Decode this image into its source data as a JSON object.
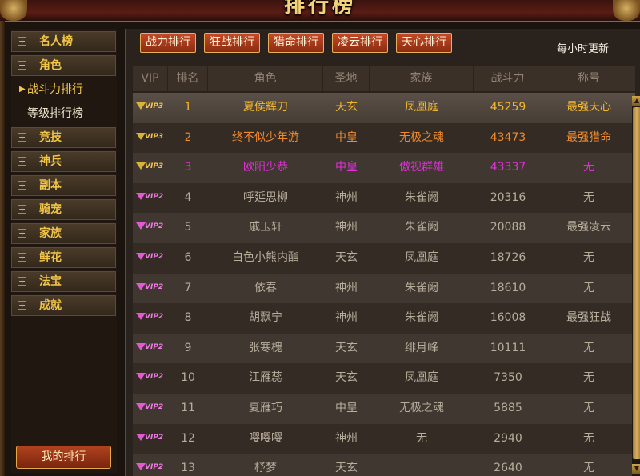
{
  "window": {
    "title": "排行榜"
  },
  "sidebar": {
    "items": [
      {
        "label": "名人榜",
        "toggle": "+"
      },
      {
        "label": "角色",
        "toggle": "−"
      },
      {
        "label": "竞技",
        "toggle": "+"
      },
      {
        "label": "神兵",
        "toggle": "+"
      },
      {
        "label": "副本",
        "toggle": "+"
      },
      {
        "label": "骑宠",
        "toggle": "+"
      },
      {
        "label": "家族",
        "toggle": "+"
      },
      {
        "label": "鲜花",
        "toggle": "+"
      },
      {
        "label": "法宝",
        "toggle": "+"
      },
      {
        "label": "成就",
        "toggle": "+"
      }
    ],
    "sub_items": [
      {
        "label": "战斗力排行",
        "active": true
      },
      {
        "label": "等级排行榜",
        "active": false
      }
    ],
    "my_rank_button": "我的排行"
  },
  "tabs": [
    "战力排行",
    "狂战排行",
    "猎命排行",
    "凌云排行",
    "天心排行"
  ],
  "update_note": "每小时更新",
  "table": {
    "headers": [
      "VIP",
      "排名",
      "角色",
      "圣地",
      "家族",
      "战斗力",
      "称号"
    ],
    "rows": [
      {
        "vip": "VIP3",
        "rank": "1",
        "name": "夏侯辉刀",
        "holyland": "天玄",
        "family": "凤凰庭",
        "power": "45259",
        "title": "最强天心"
      },
      {
        "vip": "VIP3",
        "rank": "2",
        "name": "终不似少年游",
        "holyland": "中皇",
        "family": "无极之魂",
        "power": "43473",
        "title": "最强猎命"
      },
      {
        "vip": "VIP3",
        "rank": "3",
        "name": "欧阳少恭",
        "holyland": "中皇",
        "family": "傲视群雄",
        "power": "43337",
        "title": "无"
      },
      {
        "vip": "VIP2",
        "rank": "4",
        "name": "呼延思柳",
        "holyland": "神州",
        "family": "朱雀阙",
        "power": "20316",
        "title": "无"
      },
      {
        "vip": "VIP2",
        "rank": "5",
        "name": "戚玉轩",
        "holyland": "神州",
        "family": "朱雀阙",
        "power": "20088",
        "title": "最强凌云"
      },
      {
        "vip": "VIP2",
        "rank": "6",
        "name": "白色小熊内酯",
        "holyland": "天玄",
        "family": "凤凰庭",
        "power": "18726",
        "title": "无"
      },
      {
        "vip": "VIP2",
        "rank": "7",
        "name": "依春",
        "holyland": "神州",
        "family": "朱雀阙",
        "power": "18610",
        "title": "无"
      },
      {
        "vip": "VIP2",
        "rank": "8",
        "name": "胡飘宁",
        "holyland": "神州",
        "family": "朱雀阙",
        "power": "16008",
        "title": "最强狂战"
      },
      {
        "vip": "VIP2",
        "rank": "9",
        "name": "张寒槐",
        "holyland": "天玄",
        "family": "绯月峰",
        "power": "10111",
        "title": "无"
      },
      {
        "vip": "VIP2",
        "rank": "10",
        "name": "江雁蕊",
        "holyland": "天玄",
        "family": "凤凰庭",
        "power": "7350",
        "title": "无"
      },
      {
        "vip": "VIP2",
        "rank": "11",
        "name": "夏雁巧",
        "holyland": "中皇",
        "family": "无极之魂",
        "power": "5885",
        "title": "无"
      },
      {
        "vip": "VIP2",
        "rank": "12",
        "name": "嘤嘤嘤",
        "holyland": "神州",
        "family": "无",
        "power": "2940",
        "title": "无"
      },
      {
        "vip": "VIP2",
        "rank": "13",
        "name": "杼梦",
        "holyland": "天玄",
        "family": "",
        "power": "2640",
        "title": "无"
      }
    ]
  },
  "colors": {
    "rank1": "#f4b82e",
    "rank2": "#ef8a2e",
    "rank3": "#e02fd8",
    "accent": "#f2c545"
  }
}
